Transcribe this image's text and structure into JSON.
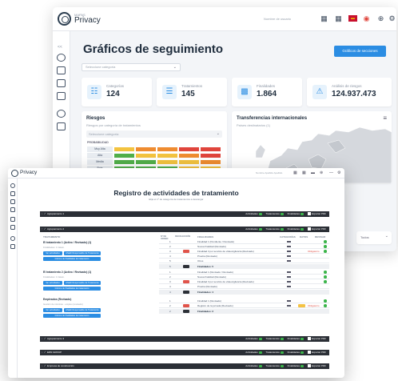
{
  "back_window": {
    "brand_sub": "MAPAS",
    "brand": "Privacy",
    "user": "Nombre de usuario",
    "toolbar_icons": [
      "building-icon",
      "grid-icon",
      "flag-es-icon",
      "chrome-icon",
      "plus-circle-icon",
      "settings-icon"
    ],
    "title": "Gráficos de seguimiento",
    "action_button": "Gráficos de secciones",
    "category_select_placeholder": "Seleccione categoría",
    "kpis": [
      {
        "icon": "sitemap-icon",
        "label": "Categorías",
        "value": "124"
      },
      {
        "icon": "list-icon",
        "label": "Tratamientos",
        "value": "145"
      },
      {
        "icon": "bar-chart-icon",
        "label": "Finalidades",
        "value": "1.864"
      },
      {
        "icon": "warning-icon",
        "label": "Análisis de riesgos",
        "value": "124.937.473"
      }
    ],
    "risks": {
      "title": "Riesgos",
      "subtitle": "Riesgos por categoría de tratamientos",
      "select_placeholder": "Seleccione categoría",
      "probability_label": "PROBABILIDAD",
      "rows": [
        "Muy Alta",
        "Alta",
        "Media",
        "Baja"
      ],
      "colors": {
        "green": "#52b04a",
        "yellow": "#f3c33f",
        "orange": "#ef8c30",
        "red": "#e0453c"
      }
    },
    "transfers": {
      "title": "Transferencias internacionales",
      "subtitle": "Países destinatarios (1)"
    },
    "bottom_select": "Todos"
  },
  "front_window": {
    "brand": "Privacy",
    "user": "Nombre Apellido Apellido",
    "title": "Registro de actividades de tratamiento",
    "subtitle": "Elija el nº de categoría de tratamientos a descargar",
    "section_tags": {
      "a": "Actividades",
      "b": "Tratamientos",
      "c": "Finalidades",
      "export": "Exportar PDF"
    },
    "sections": [
      {
        "label": "Agrupamiento 1",
        "open": false
      },
      {
        "label": "Agrupamiento 2",
        "open": true
      },
      {
        "label": "Agrupamiento 3",
        "open": false
      },
      {
        "label": "EDN GROUP",
        "open": false
      },
      {
        "label": "Empresa de construcción",
        "open": false
      }
    ],
    "columns": {
      "tratamiento": "TRATAMIENTO",
      "num": "Nº DE ORDEN",
      "delegado": "RECOLECCIÓN",
      "finalidades": "FINALIDADES",
      "categorias": "CATEGORÍAS",
      "datos": "DATOS",
      "revisar": "REVISAR"
    },
    "activities": [
      {
        "name": "El tratamiento 1 (Activo / Revisado) (1)",
        "sub": "Finalidades: 1 tratam.",
        "buttons": [
          "Ver actividades",
          "Añadir Responsable de Tratamiento",
          "Informe de finalidades de tratamiento"
        ]
      },
      {
        "name": "El tratamiento 2 (Activo / Revisado) (1)",
        "sub": "Finalidades: 1 tratam.",
        "buttons": [
          "Ver actividades",
          "Añadir Responsable de Tratamiento",
          "Informe de finalidades de tratamiento"
        ]
      },
      {
        "name": "Empleados (Revisado)",
        "sub": "Gestión de nóminas · empleo (revisado)",
        "buttons": [
          "Ver actividades",
          "Añadir Responsable de Tratamiento",
          "Informe de finalidades de tratamiento"
        ]
      }
    ],
    "finalidades_group_1": [
      "Finalidad 1 (Pendiente / Revisado)",
      "Nueva finalidad (Revisado)",
      "Finalidad 3 por servicio de videovigilancia (Revisado)",
      "Prueba (Revisado)",
      "Otros"
    ],
    "summary_1": "Finalidades: 5",
    "finalidades_group_2": [
      "Finalidad 1 (Revisado / Revisado)",
      "Nueva finalidad (Revisado)",
      "Finalidad 3 por servicio de videovigilancia (Revisado)",
      "Prueba (Revisado)"
    ],
    "summary_2": "Finalidades: 4",
    "finalidades_group_3": [
      "Finalidad 1 (Revisado)",
      "Registro de la jornada (Revisado)"
    ],
    "summary_3": "Finalidades: 2",
    "pending_label": "Obligatorio"
  }
}
